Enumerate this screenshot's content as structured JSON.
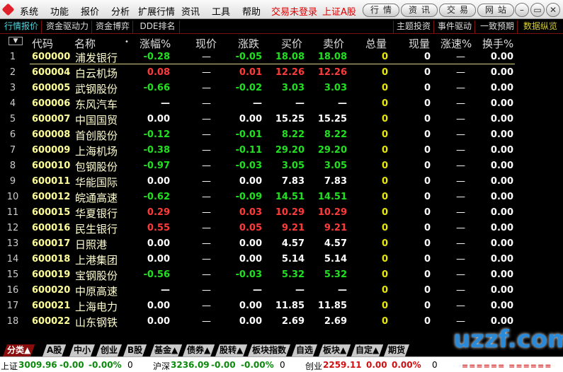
{
  "menu": {
    "items": [
      "系统",
      "功能",
      "报价",
      "分析",
      "扩展行情",
      "资讯",
      "工具",
      "帮助"
    ],
    "login_status": "交易未登录",
    "market": "上证A股",
    "buttons": [
      "行情",
      "资讯",
      "交易",
      "网站"
    ]
  },
  "tabs": {
    "left": [
      "行情报价",
      "资金驱动力",
      "资金博弈",
      "DDE排名"
    ],
    "right": [
      "主题投资",
      "事件驱动",
      "一致预期",
      "数据纵览"
    ]
  },
  "header": {
    "code": "代码",
    "name": "名称",
    "dot": "•",
    "pct": "涨幅%",
    "price": "现价",
    "change": "涨跌",
    "bid": "买价",
    "ask": "卖价",
    "volume": "总量",
    "cur_vol": "现量",
    "speed": "涨速%",
    "turnover": "换手%"
  },
  "rows": [
    {
      "n": "1",
      "code": "600000",
      "name": "浦发银行",
      "pct": "-0.28",
      "price": "—",
      "chg": "-0.05",
      "bid": "18.08",
      "ask": "18.08",
      "vol": "0",
      "cv": "0",
      "spd": "—",
      "to": "0.00",
      "dir": "dn"
    },
    {
      "n": "2",
      "code": "600004",
      "name": "白云机场",
      "pct": "0.08",
      "price": "—",
      "chg": "0.01",
      "bid": "12.26",
      "ask": "12.26",
      "vol": "0",
      "cv": "0",
      "spd": "—",
      "to": "0.00",
      "dir": "up"
    },
    {
      "n": "3",
      "code": "600005",
      "name": "武钢股份",
      "pct": "-0.66",
      "price": "—",
      "chg": "-0.02",
      "bid": "3.03",
      "ask": "3.03",
      "vol": "0",
      "cv": "0",
      "spd": "—",
      "to": "0.00",
      "dir": "dn"
    },
    {
      "n": "4",
      "code": "600006",
      "name": "东风汽车",
      "pct": "—",
      "price": "—",
      "chg": "—",
      "bid": "—",
      "ask": "—",
      "vol": "0",
      "cv": "0",
      "spd": "—",
      "to": "0.00",
      "dir": "flat"
    },
    {
      "n": "5",
      "code": "600007",
      "name": "中国国贸",
      "pct": "0.00",
      "price": "—",
      "chg": "0.00",
      "bid": "15.25",
      "ask": "15.25",
      "vol": "0",
      "cv": "0",
      "spd": "—",
      "to": "0.00",
      "dir": "flat"
    },
    {
      "n": "6",
      "code": "600008",
      "name": "首创股份",
      "pct": "-0.12",
      "price": "—",
      "chg": "-0.01",
      "bid": "8.22",
      "ask": "8.22",
      "vol": "0",
      "cv": "0",
      "spd": "—",
      "to": "0.00",
      "dir": "dn"
    },
    {
      "n": "7",
      "code": "600009",
      "name": "上海机场",
      "pct": "-0.38",
      "price": "—",
      "chg": "-0.11",
      "bid": "29.20",
      "ask": "29.20",
      "vol": "0",
      "cv": "0",
      "spd": "—",
      "to": "0.00",
      "dir": "dn"
    },
    {
      "n": "8",
      "code": "600010",
      "name": "包钢股份",
      "pct": "-0.97",
      "price": "—",
      "chg": "-0.03",
      "bid": "3.05",
      "ask": "3.05",
      "vol": "0",
      "cv": "0",
      "spd": "—",
      "to": "0.00",
      "dir": "dn"
    },
    {
      "n": "9",
      "code": "600011",
      "name": "华能国际",
      "pct": "0.00",
      "price": "—",
      "chg": "0.00",
      "bid": "7.83",
      "ask": "7.83",
      "vol": "0",
      "cv": "0",
      "spd": "—",
      "to": "0.00",
      "dir": "flat"
    },
    {
      "n": "10",
      "code": "600012",
      "name": "皖通高速",
      "pct": "-0.62",
      "price": "—",
      "chg": "-0.09",
      "bid": "14.51",
      "ask": "14.51",
      "vol": "0",
      "cv": "0",
      "spd": "—",
      "to": "0.00",
      "dir": "dn"
    },
    {
      "n": "11",
      "code": "600015",
      "name": "华夏银行",
      "pct": "0.29",
      "price": "—",
      "chg": "0.03",
      "bid": "10.29",
      "ask": "10.29",
      "vol": "0",
      "cv": "0",
      "spd": "—",
      "to": "0.00",
      "dir": "up"
    },
    {
      "n": "12",
      "code": "600016",
      "name": "民生银行",
      "pct": "0.55",
      "price": "—",
      "chg": "0.05",
      "bid": "9.21",
      "ask": "9.21",
      "vol": "0",
      "cv": "0",
      "spd": "—",
      "to": "0.00",
      "dir": "up"
    },
    {
      "n": "13",
      "code": "600017",
      "name": "日照港",
      "pct": "0.00",
      "price": "—",
      "chg": "0.00",
      "bid": "4.57",
      "ask": "4.57",
      "vol": "0",
      "cv": "0",
      "spd": "—",
      "to": "0.00",
      "dir": "flat"
    },
    {
      "n": "14",
      "code": "600018",
      "name": "上港集团",
      "pct": "0.00",
      "price": "—",
      "chg": "0.00",
      "bid": "5.14",
      "ask": "5.14",
      "vol": "0",
      "cv": "0",
      "spd": "—",
      "to": "0.00",
      "dir": "flat"
    },
    {
      "n": "15",
      "code": "600019",
      "name": "宝钢股份",
      "pct": "-0.56",
      "price": "—",
      "chg": "-0.03",
      "bid": "5.32",
      "ask": "5.32",
      "vol": "0",
      "cv": "0",
      "spd": "—",
      "to": "0.00",
      "dir": "dn"
    },
    {
      "n": "16",
      "code": "600020",
      "name": "中原高速",
      "pct": "—",
      "price": "—",
      "chg": "—",
      "bid": "—",
      "ask": "—",
      "vol": "0",
      "cv": "0",
      "spd": "—",
      "to": "0.00",
      "dir": "flat"
    },
    {
      "n": "17",
      "code": "600021",
      "name": "上海电力",
      "pct": "0.00",
      "price": "—",
      "chg": "0.00",
      "bid": "11.85",
      "ask": "11.85",
      "vol": "0",
      "cv": "0",
      "spd": "—",
      "to": "0.00",
      "dir": "flat"
    },
    {
      "n": "18",
      "code": "600022",
      "name": "山东钢铁",
      "pct": "0.00",
      "price": "—",
      "chg": "0.00",
      "bid": "2.69",
      "ask": "2.69",
      "vol": "0",
      "cv": "0",
      "spd": "—",
      "to": "0.00",
      "dir": "flat"
    }
  ],
  "bottom_tabs": [
    "分类▲",
    "A股",
    "中小",
    "创业",
    "B股",
    "基金▲",
    "债券▲",
    "股转▲",
    "板块指数",
    "自选",
    "板块▲",
    "自定▲",
    "期货"
  ],
  "status": {
    "sh_label": "上证",
    "sh_val": "3009.96",
    "sh_chg": "-0.00",
    "sh_pct": "-0.00%",
    "sh_vol": "0",
    "hs_label": "沪深",
    "hs_val": "3236.09",
    "hs_chg": "-0.00",
    "hs_pct": "-0.00%",
    "hs_vol": "0",
    "cy_label": "创业",
    "cy_val": "2259.11",
    "cy_chg": "0.00",
    "cy_pct": "0.00%",
    "cy_vol": "0",
    "ind": "====== ======"
  },
  "watermark": "uzzf.com"
}
